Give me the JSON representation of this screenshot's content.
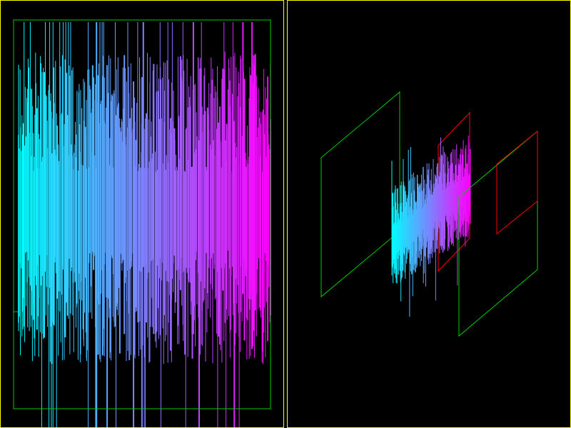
{
  "colors": {
    "background": "#000000",
    "viewport_border": "#ffff00",
    "frame_green": "#00cc00",
    "frame_red": "#ff0000",
    "signal_start": "#00ffff",
    "signal_end": "#ff00ff"
  },
  "left_view": {
    "view": "2d-signal-display",
    "trace_style": "vertical-lines-gradient"
  },
  "right_view": {
    "view": "3d-perspective-signal",
    "planes": [
      "green",
      "green",
      "red",
      "red"
    ]
  }
}
